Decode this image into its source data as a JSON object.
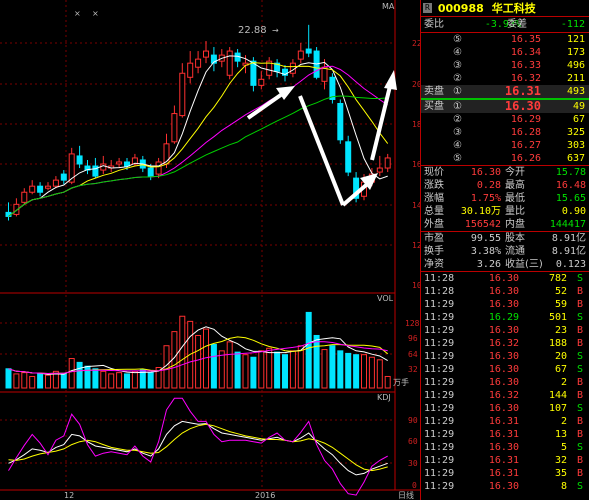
{
  "chart": {
    "ma_label": "MA",
    "vol_label": "VOL",
    "kdj_label": "KDJ",
    "vol_unit": "万手",
    "date_label_1": "12",
    "date_label_2": "2016",
    "bottom_right_label": "日线",
    "peak_label": "22.88",
    "price_axis": [
      "22",
      "20",
      "18",
      "16",
      "14",
      "12",
      "10"
    ],
    "vol_axis": [
      "128",
      "96",
      "64",
      "32"
    ],
    "kdj_axis": [
      "90",
      "60",
      "30",
      "0"
    ],
    "top_icons": [
      "×",
      "×"
    ]
  },
  "stock": {
    "badge": "R",
    "code": "000988",
    "name": "华工科技"
  },
  "commission": {
    "ratio_label": "委比",
    "ratio": "-3.93%",
    "diff_label": "委差",
    "diff": "-112"
  },
  "asks": [
    {
      "label": "",
      "num": "⑤",
      "price": "16.35",
      "vol": "121"
    },
    {
      "label": "",
      "num": "④",
      "price": "16.34",
      "vol": "173"
    },
    {
      "label": "",
      "num": "③",
      "price": "16.33",
      "vol": "496"
    },
    {
      "label": "",
      "num": "②",
      "price": "16.32",
      "vol": "211"
    },
    {
      "label": "卖盘",
      "num": "①",
      "price": "16.31",
      "vol": "493"
    }
  ],
  "bids": [
    {
      "label": "买盘",
      "num": "①",
      "price": "16.30",
      "vol": "49"
    },
    {
      "label": "",
      "num": "②",
      "price": "16.29",
      "vol": "67"
    },
    {
      "label": "",
      "num": "③",
      "price": "16.28",
      "vol": "325"
    },
    {
      "label": "",
      "num": "④",
      "price": "16.27",
      "vol": "303"
    },
    {
      "label": "",
      "num": "⑤",
      "price": "16.26",
      "vol": "637"
    }
  ],
  "info1": [
    {
      "l1": "现价",
      "v1": "16.30",
      "l2": "今开",
      "v2": "15.78"
    },
    {
      "l1": "涨跌",
      "v1": "0.28",
      "l2": "最高",
      "v2": "16.48"
    },
    {
      "l1": "涨幅",
      "v1": "1.75%",
      "l2": "最低",
      "v2": "15.65"
    },
    {
      "l1": "总量",
      "v1": "30.10万",
      "l2": "量比",
      "v2": "0.90"
    },
    {
      "l1": "外盘",
      "v1": "156542",
      "l2": "内盘",
      "v2": "144417"
    }
  ],
  "info2": [
    {
      "l1": "市盈",
      "v1": "99.55",
      "l2": "股本",
      "v2": "8.91亿"
    },
    {
      "l1": "换手",
      "v1": "3.38%",
      "l2": "流通",
      "v2": "8.91亿"
    },
    {
      "l1": "净资",
      "v1": "3.26",
      "l2": "收益(三)",
      "v2": "0.123"
    }
  ],
  "ticks": [
    {
      "t": "11:28",
      "p": "16.30",
      "v": "782",
      "s": "S"
    },
    {
      "t": "11:28",
      "p": "16.30",
      "v": "52",
      "s": "B"
    },
    {
      "t": "11:29",
      "p": "16.30",
      "v": "59",
      "s": "B"
    },
    {
      "t": "11:29",
      "p": "16.29",
      "v": "501",
      "s": "S"
    },
    {
      "t": "11:29",
      "p": "16.30",
      "v": "23",
      "s": "B"
    },
    {
      "t": "11:29",
      "p": "16.32",
      "v": "188",
      "s": "B"
    },
    {
      "t": "11:29",
      "p": "16.30",
      "v": "20",
      "s": "S"
    },
    {
      "t": "11:29",
      "p": "16.30",
      "v": "67",
      "s": "S"
    },
    {
      "t": "11:29",
      "p": "16.30",
      "v": "2",
      "s": "B"
    },
    {
      "t": "11:29",
      "p": "16.32",
      "v": "144",
      "s": "B"
    },
    {
      "t": "11:29",
      "p": "16.30",
      "v": "107",
      "s": "S"
    },
    {
      "t": "11:29",
      "p": "16.31",
      "v": "2",
      "s": "B"
    },
    {
      "t": "11:29",
      "p": "16.31",
      "v": "13",
      "s": "B"
    },
    {
      "t": "11:29",
      "p": "16.30",
      "v": "5",
      "s": "S"
    },
    {
      "t": "11:29",
      "p": "16.31",
      "v": "32",
      "s": "B"
    },
    {
      "t": "11:29",
      "p": "16.31",
      "v": "35",
      "s": "B"
    },
    {
      "t": "11:29",
      "p": "16.30",
      "v": "8",
      "s": "S"
    }
  ],
  "chart_data": {
    "type": "candlestick",
    "title": "",
    "price_range": [
      10,
      23
    ],
    "candles": [
      [
        13.6,
        13.4,
        14.1,
        13.2
      ],
      [
        13.5,
        14.0,
        14.3,
        13.4
      ],
      [
        14.1,
        14.6,
        14.8,
        14.0
      ],
      [
        14.6,
        14.9,
        15.2,
        14.5
      ],
      [
        14.9,
        14.6,
        15.1,
        14.4
      ],
      [
        14.8,
        14.9,
        15.1,
        14.7
      ],
      [
        14.9,
        15.2,
        15.4,
        14.8
      ],
      [
        15.5,
        15.2,
        15.7,
        15.0
      ],
      [
        15.1,
        16.5,
        16.8,
        15.0
      ],
      [
        16.4,
        16.0,
        16.9,
        15.8
      ],
      [
        15.9,
        15.7,
        16.2,
        15.5
      ],
      [
        15.9,
        15.4,
        16.3,
        15.3
      ],
      [
        15.7,
        16.0,
        16.4,
        15.5
      ],
      [
        15.8,
        15.9,
        16.2,
        15.6
      ],
      [
        16.0,
        16.1,
        16.3,
        15.8
      ],
      [
        16.1,
        15.9,
        16.3,
        15.7
      ],
      [
        16.0,
        16.3,
        16.5,
        15.9
      ],
      [
        16.2,
        15.8,
        16.4,
        15.6
      ],
      [
        15.8,
        15.4,
        16.0,
        15.2
      ],
      [
        15.5,
        16.1,
        16.3,
        15.3
      ],
      [
        16.0,
        17.0,
        17.5,
        15.8
      ],
      [
        17.1,
        18.5,
        18.9,
        17.0
      ],
      [
        18.4,
        20.5,
        21.0,
        18.3
      ],
      [
        20.3,
        21.0,
        21.6,
        20.0
      ],
      [
        20.8,
        21.2,
        21.6,
        20.5
      ],
      [
        21.3,
        21.6,
        22.1,
        21.0
      ],
      [
        21.4,
        21.0,
        21.8,
        20.6
      ],
      [
        21.1,
        21.4,
        21.7,
        20.8
      ],
      [
        20.4,
        21.6,
        21.8,
        20.2
      ],
      [
        21.5,
        21.1,
        21.7,
        20.8
      ],
      [
        20.9,
        21.0,
        21.4,
        20.5
      ],
      [
        21.1,
        19.9,
        21.3,
        19.6
      ],
      [
        19.9,
        20.2,
        20.6,
        19.7
      ],
      [
        20.4,
        21.1,
        21.3,
        20.2
      ],
      [
        21.0,
        20.6,
        21.2,
        20.3
      ],
      [
        20.7,
        20.4,
        20.9,
        20.1
      ],
      [
        20.5,
        21.0,
        21.2,
        20.3
      ],
      [
        21.2,
        21.6,
        22.0,
        21.0
      ],
      [
        21.7,
        21.5,
        22.9,
        21.3
      ],
      [
        21.6,
        20.3,
        21.8,
        20.2
      ],
      [
        20.1,
        20.8,
        21.2,
        19.7
      ],
      [
        20.3,
        19.2,
        20.5,
        19.0
      ],
      [
        19.0,
        17.2,
        19.2,
        17.0
      ],
      [
        17.1,
        15.6,
        17.4,
        15.4
      ],
      [
        15.3,
        14.3,
        15.6,
        14.1
      ],
      [
        14.4,
        15.1,
        15.5,
        14.2
      ],
      [
        15.1,
        15.5,
        15.8,
        14.9
      ],
      [
        15.6,
        15.8,
        16.4,
        15.4
      ],
      [
        15.8,
        16.3,
        16.5,
        15.6
      ]
    ],
    "volumes": [
      30,
      22,
      24,
      18,
      22,
      20,
      26,
      22,
      46,
      40,
      34,
      30,
      26,
      22,
      24,
      22,
      26,
      28,
      24,
      32,
      66,
      88,
      112,
      104,
      82,
      92,
      68,
      58,
      72,
      56,
      52,
      48,
      58,
      62,
      56,
      52,
      58,
      66,
      118,
      82,
      60,
      66,
      58,
      54,
      52,
      52,
      48,
      44,
      18
    ],
    "kdj": {
      "k": [
        30,
        35,
        42,
        50,
        48,
        45,
        52,
        56,
        70,
        68,
        60,
        54,
        52,
        50,
        48,
        46,
        50,
        44,
        40,
        50,
        70,
        82,
        88,
        86,
        84,
        85,
        78,
        72,
        70,
        68,
        66,
        64,
        62,
        64,
        66,
        62,
        60,
        65,
        72,
        60,
        50,
        42,
        30,
        20,
        14,
        16,
        22,
        26,
        30
      ],
      "d": [
        35,
        34,
        36,
        40,
        43,
        45,
        47,
        50,
        56,
        60,
        62,
        60,
        56,
        52,
        50,
        48,
        48,
        46,
        44,
        45,
        53,
        63,
        72,
        78,
        82,
        84,
        82,
        78,
        74,
        71,
        68,
        66,
        64,
        63,
        63,
        62,
        60,
        61,
        64,
        62,
        58,
        52,
        44,
        36,
        28,
        22,
        20,
        22,
        25
      ],
      "j": [
        20,
        38,
        55,
        70,
        58,
        42,
        62,
        68,
        98,
        84,
        56,
        40,
        44,
        46,
        44,
        42,
        54,
        40,
        32,
        60,
        104,
        120,
        120,
        102,
        88,
        88,
        70,
        60,
        62,
        62,
        62,
        60,
        58,
        66,
        72,
        62,
        60,
        73,
        88,
        56,
        34,
        22,
        2,
        -12,
        -14,
        4,
        26,
        34,
        40
      ]
    }
  }
}
